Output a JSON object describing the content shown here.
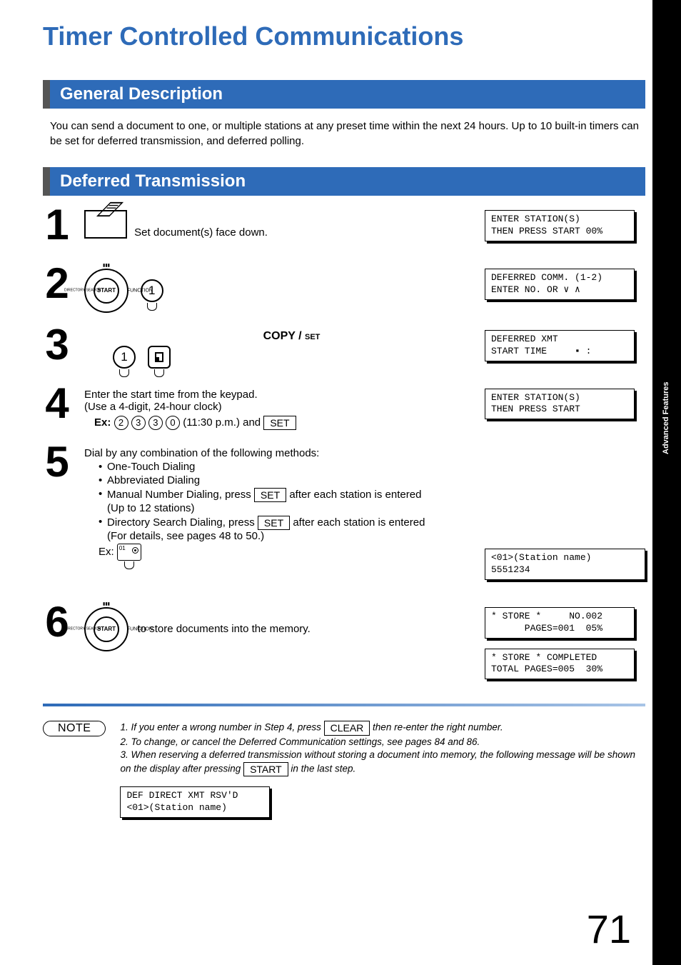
{
  "title": "Timer Controlled Communications",
  "side_tab": "Advanced\nFeatures",
  "sections": {
    "general": {
      "heading": "General Description",
      "text": "You can send a document to one, or multiple stations at any preset time within the next 24 hours. Up to 10 built-in timers can be set for deferred transmission, and deferred polling."
    },
    "deferred": {
      "heading": "Deferred Transmission"
    }
  },
  "steps": {
    "s1": {
      "num": "1",
      "text": "Set document(s) face down.",
      "lcd": "ENTER STATION(S)\nTHEN PRESS START 00%"
    },
    "s2": {
      "num": "2",
      "dial_center": "START",
      "dial_left": "DIRECTORY\nSEARCH",
      "dial_right": "FUNCTION",
      "key": "1",
      "lcd": "DEFERRED COMM. (1-2)\nENTER NO. OR ∨ ∧"
    },
    "s3": {
      "num": "3",
      "copy_set": "COPY / SET",
      "key1": "1",
      "lcd": "DEFERRED XMT\nSTART TIME     ▪ :"
    },
    "s4": {
      "num": "4",
      "line1": "Enter the start time from the keypad.",
      "line2": "(Use a 4-digit, 24-hour clock)",
      "ex_label": "Ex:",
      "digits": [
        "2",
        "3",
        "3",
        "0"
      ],
      "ex_tail": " (11:30 p.m.) and  ",
      "set_key": "SET",
      "lcd": "ENTER STATION(S)\nTHEN PRESS START"
    },
    "s5": {
      "num": "5",
      "intro": "Dial by any combination of the following methods:",
      "items": [
        "One-Touch Dialing",
        "Abbreviated Dialing"
      ],
      "manual_a": "Manual Number Dialing, press  ",
      "manual_key": "SET",
      "manual_b": "  after each station is entered",
      "manual_c": "(Up to 12 stations)",
      "dir_a": "Directory Search Dialing, press  ",
      "dir_key": "SET",
      "dir_b": "  after each station is entered",
      "dir_c": "(For details, see pages 48 to 50.)",
      "ex_label": "Ex:",
      "onetouch_label": "01",
      "lcd": "<01>(Station name)\n5551234"
    },
    "s6": {
      "num": "6",
      "dial_center": "START",
      "dial_left": "DIRECTORY\nSEARCH",
      "dial_right": "FUNCTION",
      "tail": "to store documents into the memory.",
      "lcd1": "* STORE *     NO.002\n      PAGES=001  05%",
      "lcd2": "* STORE * COMPLETED\nTOTAL PAGES=005  30%"
    }
  },
  "note": {
    "badge": "NOTE",
    "n1a": "1. If you enter a wrong number in Step 4, press ",
    "n1_key": "CLEAR",
    "n1b": " then re-enter the right number.",
    "n2": "2. To change, or cancel the Deferred Communication settings, see pages 84 and 86.",
    "n3a": "3. When reserving a deferred transmission without storing a document into memory, the following message will be shown on the display after pressing ",
    "n3_key": "START",
    "n3b": " in the last step.",
    "lcd": "DEF DIRECT XMT RSV'D\n<01>(Station name)"
  },
  "page_number": "71"
}
